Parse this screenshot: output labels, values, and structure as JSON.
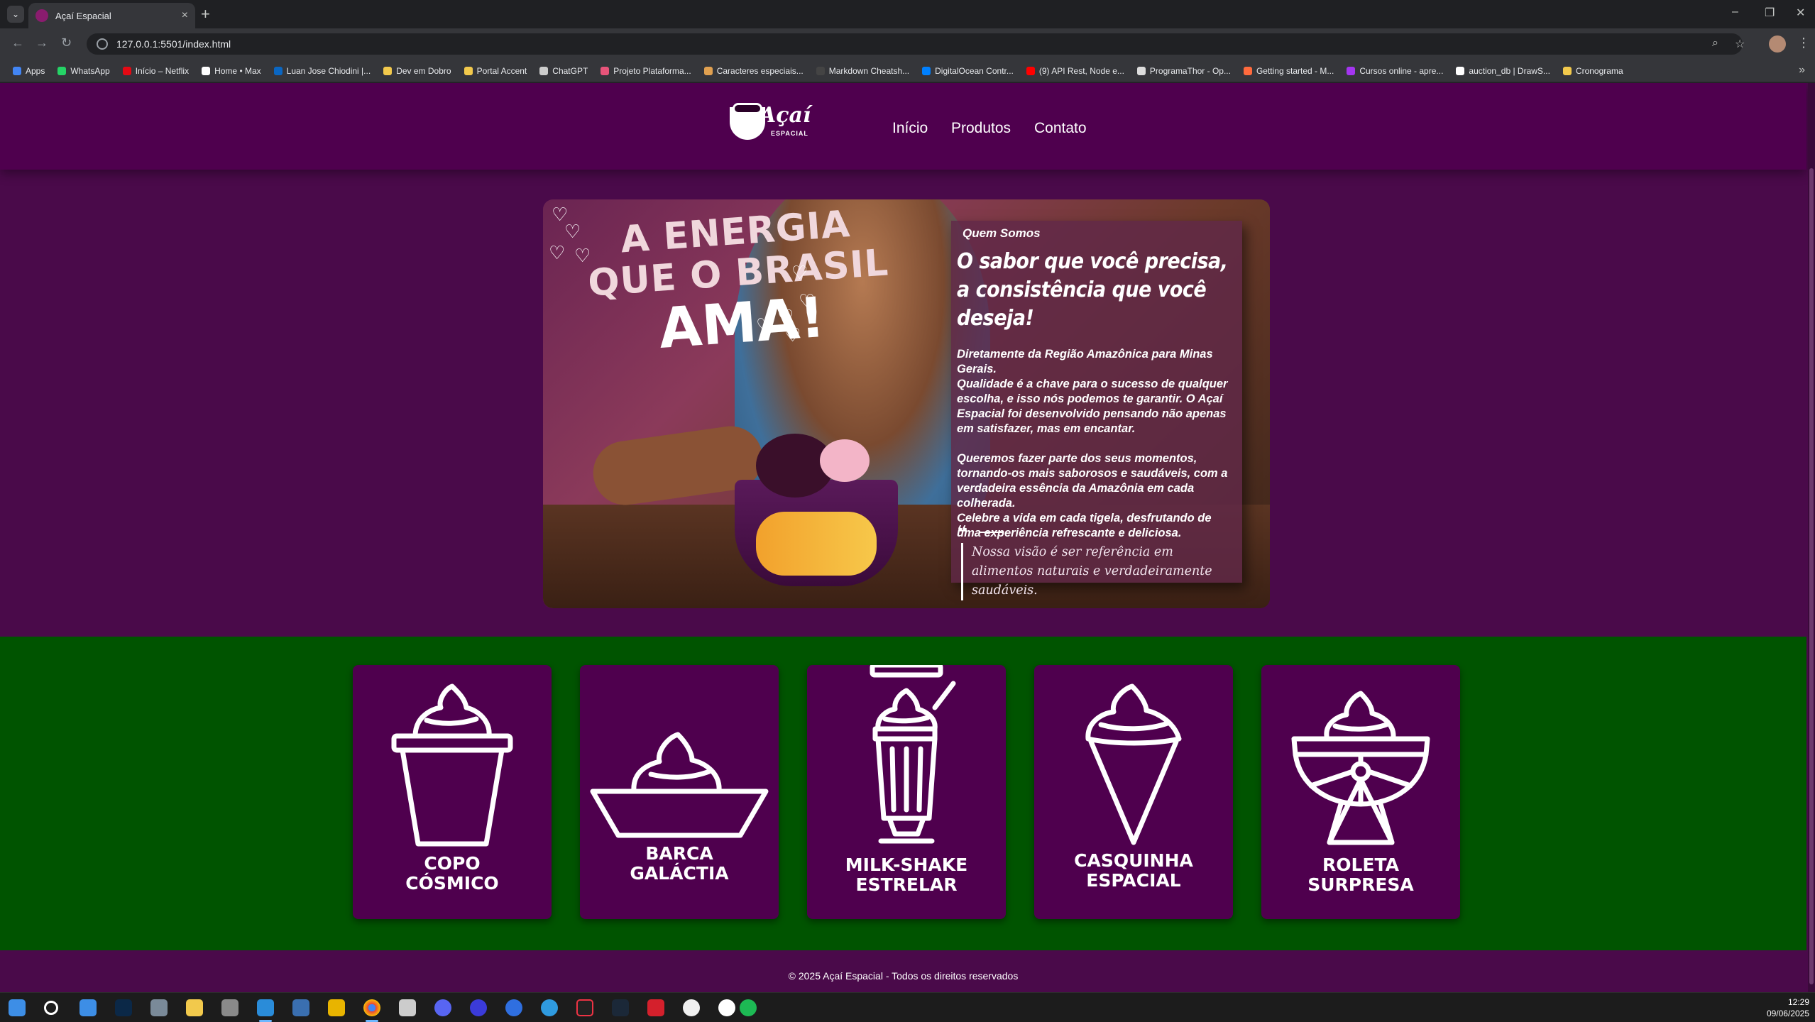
{
  "browser": {
    "tab_title": "Açaí Espacial",
    "url": "127.0.0.1:5501/index.html",
    "bookmarks": [
      {
        "label": "Apps",
        "color": "#4285f4"
      },
      {
        "label": "WhatsApp",
        "color": "#25d366"
      },
      {
        "label": "Início – Netflix",
        "color": "#e50914"
      },
      {
        "label": "Home • Max",
        "color": "#ffffff"
      },
      {
        "label": "Luan Jose Chiodini |...",
        "color": "#0a66c2"
      },
      {
        "label": "Dev em Dobro",
        "color": "#f2c94c"
      },
      {
        "label": "Portal Accent",
        "color": "#f2c94c"
      },
      {
        "label": "ChatGPT",
        "color": "#cccccc"
      },
      {
        "label": "Projeto Plataforma...",
        "color": "#e8547a"
      },
      {
        "label": "Caracteres especiais...",
        "color": "#e0a050"
      },
      {
        "label": "Markdown Cheatsh...",
        "color": "#444444"
      },
      {
        "label": "DigitalOcean Contr...",
        "color": "#0080ff"
      },
      {
        "label": "(9) API Rest, Node e...",
        "color": "#ff0000"
      },
      {
        "label": "ProgramaThor - Op...",
        "color": "#dddddd"
      },
      {
        "label": "Getting started - M...",
        "color": "#ff6a3d"
      },
      {
        "label": "Cursos online - apre...",
        "color": "#a435f0"
      },
      {
        "label": "auction_db | DrawS...",
        "color": "#ffffff"
      },
      {
        "label": "Cronograma",
        "color": "#f2c94c"
      }
    ]
  },
  "site": {
    "logo_word": "Açaí",
    "logo_sub": "ESPACIAL",
    "nav": [
      "Início",
      "Produtos",
      "Contato"
    ],
    "hero_headline": [
      "A ENERGIA",
      "QUE O BRASIL",
      "AMA!"
    ],
    "about": {
      "kicker": "Quem Somos",
      "title": "O sabor que você precisa, a consistência que você deseja!",
      "p1": "Diretamente da Região Amazônica para Minas Gerais.",
      "p2": "Qualidade é a chave para o sucesso de qualquer escolha, e isso nós podemos te garantir. O Açaí Espacial foi desenvolvido pensando não apenas em satisfazer, mas em encantar.",
      "p3": "Queremos fazer parte dos seus momentos, tornando-os mais saborosos e saudáveis, com a verdadeira essência da Amazônia em cada colherada.",
      "p4": "Celebre a vida em cada tigela, desfrutando de uma experiência refrescante e deliciosa.",
      "quote": "Nossa visão é ser referência em alimentos naturais e verdadeiramente saudáveis."
    },
    "products": [
      {
        "line1": "COPO",
        "line2": "CÓSMICO",
        "icon": "cup-icon"
      },
      {
        "line1": "BARCA",
        "line2": "GALÁCTIA",
        "icon": "bowl-icon"
      },
      {
        "line1": "MILK-SHAKE",
        "line2": "ESTRELAR",
        "icon": "milkshake-icon"
      },
      {
        "line1": "CASQUINHA",
        "line2": "ESPACIAL",
        "icon": "cone-icon"
      },
      {
        "line1": "ROLETA",
        "line2": "SURPRESA",
        "icon": "sundae-icon"
      }
    ],
    "footer": "© 2025 Açaí Espacial - Todos os direitos reservados",
    "colors": {
      "primary": "#4f004e",
      "band": "#005400"
    }
  },
  "taskbar": {
    "time": "12:29",
    "date": "09/06/2025"
  }
}
